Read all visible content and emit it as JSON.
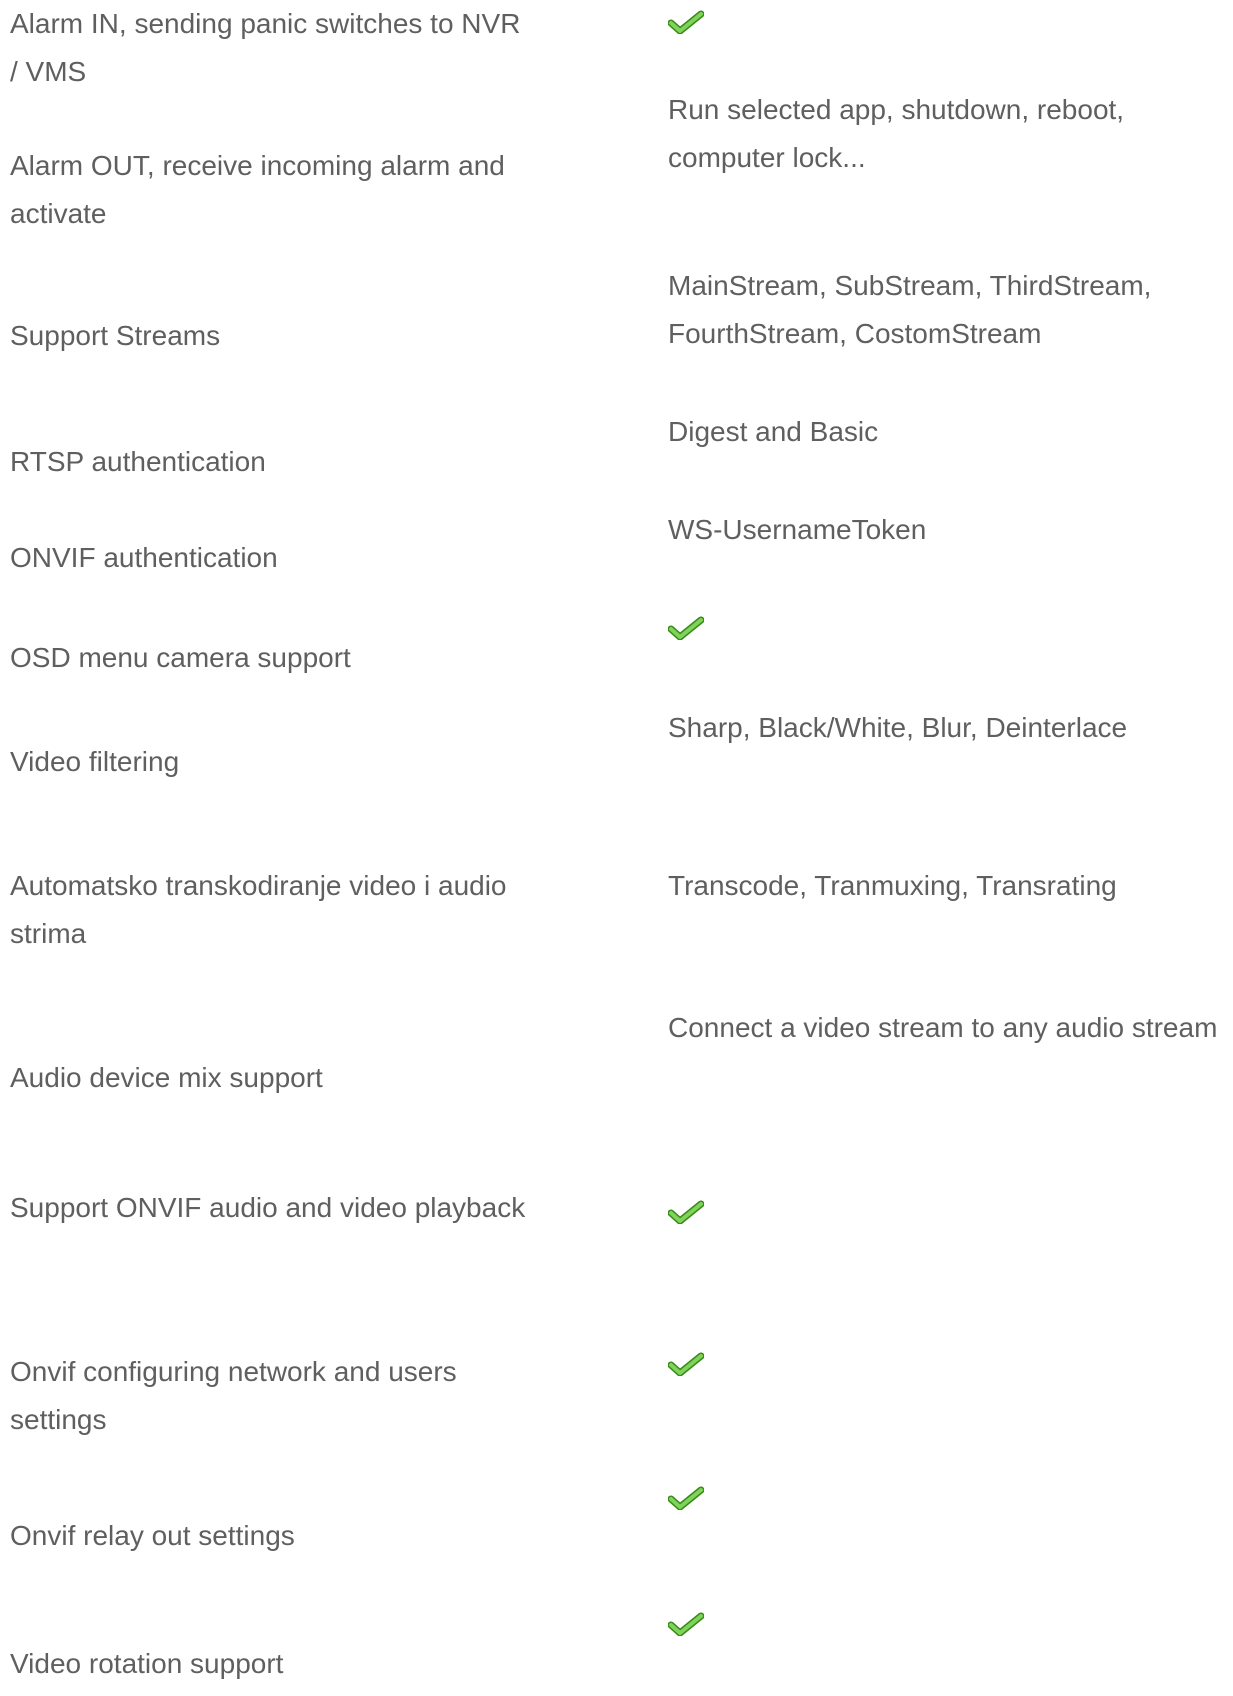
{
  "rows": [
    {
      "feature": "Alarm IN, sending panic switches to NVR / VMS",
      "value": "",
      "check": true
    },
    {
      "feature": "Alarm OUT, receive incoming alarm and activate",
      "value": "Run selected app, shutdown, reboot, computer lock...",
      "check": false
    },
    {
      "feature": "Support Streams",
      "value": "MainStream, SubStream, ThirdStream, FourthStream, CostomStream",
      "check": false
    },
    {
      "feature": "RTSP authentication",
      "value": "Digest and Basic",
      "check": false
    },
    {
      "feature": "ONVIF authentication",
      "value": "WS-UsernameToken",
      "check": false
    },
    {
      "feature": "OSD menu camera support",
      "value": "",
      "check": true
    },
    {
      "feature": "Video filtering",
      "value": " Sharp, Black/White, Blur, Deinterlace",
      "check": false
    },
    {
      "feature": "Automatsko transkodiranje video i audio strima",
      "value": "Transcode, Tranmuxing, Transrating",
      "check": false
    },
    {
      "feature": "Audio device mix support",
      "value": "Connect a video stream to any audio stream",
      "check": false
    },
    {
      "feature": "Support ONVIF audio and video playback",
      "value": "",
      "check": true
    },
    {
      "feature": "Onvif configuring network and users settings",
      "value": "",
      "check": true
    },
    {
      "feature": "Onvif relay out settings",
      "value": "",
      "check": true
    },
    {
      "feature": "Video rotation support",
      "value": "",
      "check": true
    }
  ],
  "colors": {
    "text": "#5f5f5f",
    "check_green": "#5cbf2a",
    "check_dark": "#3a8a18"
  },
  "icons": {
    "check": "green-checkmark-icon"
  }
}
